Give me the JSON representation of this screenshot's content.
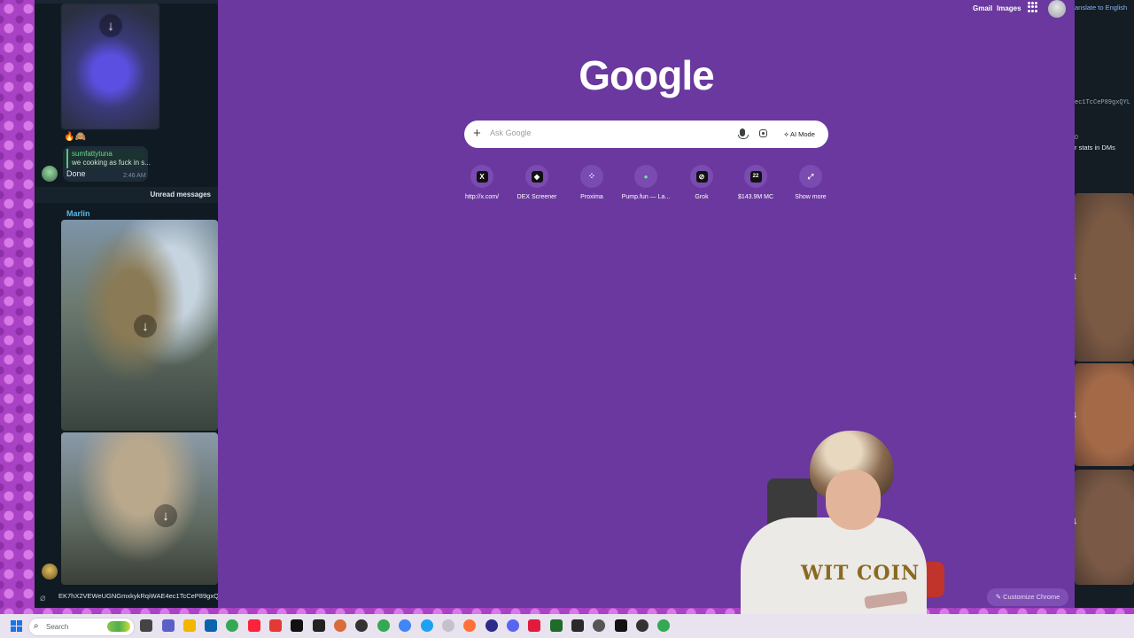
{
  "telegram": {
    "reactions": "🔥🙈",
    "reply_quote": {
      "author": "sumfattytuna",
      "text": "we cooking as fuck in s..."
    },
    "reply_text": "Done",
    "reply_time": "2:46 AM",
    "unread_label": "Unread messages",
    "sender": "Marlin",
    "input_text": "EK7hX2VEWeUGNGmxkykRqiWAE4ec1TcCeP89gxQYLJz"
  },
  "chrome": {
    "top_links": [
      "Gmail",
      "Images"
    ],
    "logo": "Google",
    "search": {
      "placeholder": "Ask Google",
      "ai_mode_label": "AI Mode"
    },
    "shortcuts": [
      {
        "label": "http://x.com/",
        "icon": "x-icon",
        "glyph": "X"
      },
      {
        "label": "DEX Screener",
        "icon": "dexscreener-icon",
        "glyph": "◆"
      },
      {
        "label": "Proxima",
        "icon": "proxima-icon",
        "glyph": "⁘"
      },
      {
        "label": "Pump.fun — La...",
        "icon": "pill-icon",
        "glyph": "●"
      },
      {
        "label": "Grok",
        "icon": "grok-icon",
        "glyph": "⊘"
      },
      {
        "label": "$143.9M MC",
        "icon": "chart-app-icon",
        "glyph": "22"
      },
      {
        "label": "Show more",
        "icon": "expand-icon",
        "glyph": "⤢"
      }
    ],
    "customize_label": "Customize Chrome"
  },
  "right_panel": {
    "translate": "anslate to English",
    "address_fragment": "ec1TcCeP89gxQYL",
    "zero": "0",
    "stats_text": "r stats in DMs"
  },
  "webcam": {
    "shirt_text": "WIT COIN"
  },
  "taskbar": {
    "search_placeholder": "Search"
  },
  "colors": {
    "ntp_background": "#6a389e",
    "telegram_background": "#0f1a22",
    "accent_green": "#69d88f",
    "accent_blue": "#5fb6e6"
  }
}
